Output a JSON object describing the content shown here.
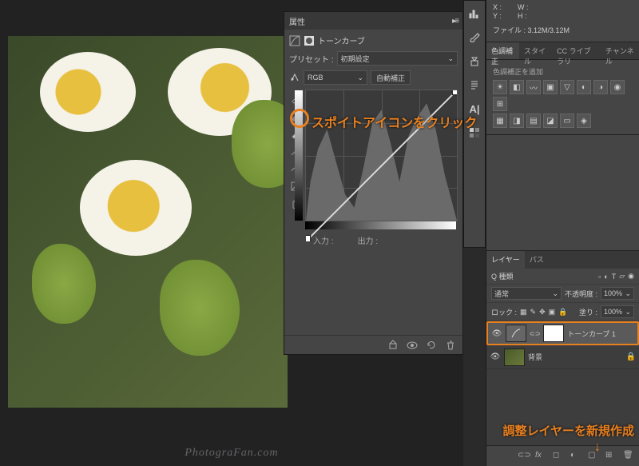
{
  "watermark": "PhotograFan.com",
  "properties": {
    "panel_title": "属性",
    "subhead": "トーンカーブ",
    "preset_label": "プリセット :",
    "preset_value": "初期設定",
    "channel": "RGB",
    "auto_button": "自動補正",
    "input_label": "入力 :",
    "output_label": "出力 :"
  },
  "info": {
    "x_label": "X :",
    "y_label": "Y :",
    "w_label": "W :",
    "h_label": "H :",
    "file_label": "ファイル :",
    "file_value": "3.12M/3.12M"
  },
  "panel_tabs": {
    "color_adjust": "色調補正",
    "style": "スタイル",
    "cc_library": "CC ライブラリ",
    "channel": "チャンネル"
  },
  "adj": {
    "hint": "色調補正を追加"
  },
  "layers": {
    "tab_layers": "レイヤー",
    "tab_paths": "パス",
    "kind_label": "Q 種類",
    "blend_mode": "通常",
    "opacity_label": "不透明度 :",
    "opacity_value": "100%",
    "lock_label": "ロック :",
    "fill_label": "塗り :",
    "fill_value": "100%",
    "items": [
      {
        "name": "トーンカーブ 1"
      },
      {
        "name": "背景"
      }
    ]
  },
  "callouts": {
    "eyedropper": "スポイトアイコンをクリック",
    "new_adj_layer": "調整レイヤーを新規作成"
  }
}
